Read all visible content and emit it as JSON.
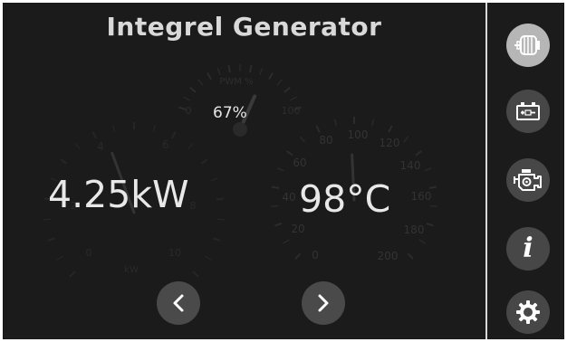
{
  "app": {
    "title": "Integrel Generator"
  },
  "pwm_gauge": {
    "label": "PWM %",
    "value_text": "67%",
    "value": 67,
    "ticks": [
      "0",
      "100"
    ]
  },
  "power_gauge": {
    "unit_label": "kW",
    "value_text": "4.25kW",
    "value": 4.25,
    "ticks": [
      "0",
      "2",
      "4",
      "6",
      "8",
      "10"
    ]
  },
  "temp_gauge": {
    "value_text": "98°C",
    "value": 98,
    "ticks": [
      "0",
      "20",
      "40",
      "60",
      "80",
      "100",
      "120",
      "140",
      "160",
      "180",
      "200"
    ]
  },
  "nav": {
    "prev_icon": "chevron-left-icon",
    "next_icon": "chevron-right-icon"
  },
  "sidebar": {
    "items": [
      {
        "icon": "generator-icon",
        "active": true
      },
      {
        "icon": "battery-icon",
        "active": false
      },
      {
        "icon": "engine-icon",
        "active": false
      },
      {
        "icon": "info-icon",
        "glyph": "i",
        "active": false
      },
      {
        "icon": "gear-icon",
        "active": false
      }
    ]
  },
  "colors": {
    "background": "#1b1b1b",
    "text": "#e8e8e8",
    "button": "#4a4a4a",
    "active_button": "#b6b6b6",
    "gauge_faint": "#2c2c2c"
  }
}
